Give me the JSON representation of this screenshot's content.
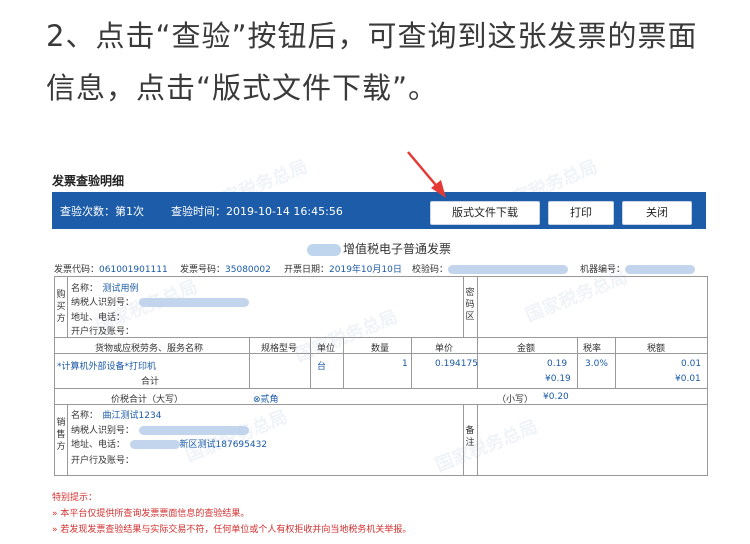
{
  "instruction": {
    "line1": "2、点击“查验”按钮后，可查询到这张发票的票面",
    "line2": "信息，点击“版式文件下载”。"
  },
  "panel": {
    "title": "发票查验明细",
    "check_count": "查验次数：第1次",
    "check_time": "查验时间：2019-10-14 16:45:56",
    "buttons": {
      "download": "版式文件下载",
      "print": "打印",
      "close": "关闭"
    },
    "invoice_title": "增值税电子普通发票",
    "meta": {
      "code_label": "发票代码：",
      "code": "061001901111",
      "number_label": "发票号码：",
      "number": "35080002",
      "date_label": "开票日期：",
      "date": "2019年10月10日",
      "check_code_label": "校验码：",
      "machine_label": "机器编号："
    },
    "buyer": {
      "section_label": "购买方",
      "name_label": "名称：",
      "name": "测试用例",
      "taxid_label": "纳税人识别号：",
      "address_label": "地址、电话：",
      "bank_label": "开户行及账号：",
      "password_label": "密码区"
    },
    "items": {
      "headers": [
        "货物或应税劳务、服务名称",
        "规格型号",
        "单位",
        "数量",
        "单价",
        "金额",
        "税率",
        "税额"
      ],
      "row": {
        "name": "*计算机外部设备*打印机",
        "unit": "台",
        "qty": "1",
        "price": "0.194175",
        "amount": "0.19",
        "rate": "3.0%",
        "tax": "0.01"
      },
      "subtotal_label": "合计",
      "subtotal_amount": "¥0.19",
      "subtotal_tax": "¥0.01"
    },
    "total": {
      "label": "价税合计（大写）",
      "words": "⊗贰角",
      "small_label": "（小写）",
      "small": "¥0.20"
    },
    "seller": {
      "section_label": "销售方",
      "name_label": "名称：",
      "name": "曲江测试1234",
      "taxid_label": "纳税人识别号：",
      "address_label": "地址、电话：",
      "address": "新区测试187695432",
      "bank_label": "开户行及账号：",
      "remark_label": "备注"
    },
    "notes": {
      "heading": "特别提示：",
      "items": [
        "»  本平台仅提供所查询发票票面信息的查验结果。",
        "»  若发现发票查验结果与实际交易不符，任何单位或个人有权拒收并向当地税务机关举报。"
      ]
    }
  },
  "colors": {
    "bar": "#1c5ca8",
    "arrow": "#e53935",
    "note": "#d32f2f",
    "value": "#1a5aa8"
  }
}
